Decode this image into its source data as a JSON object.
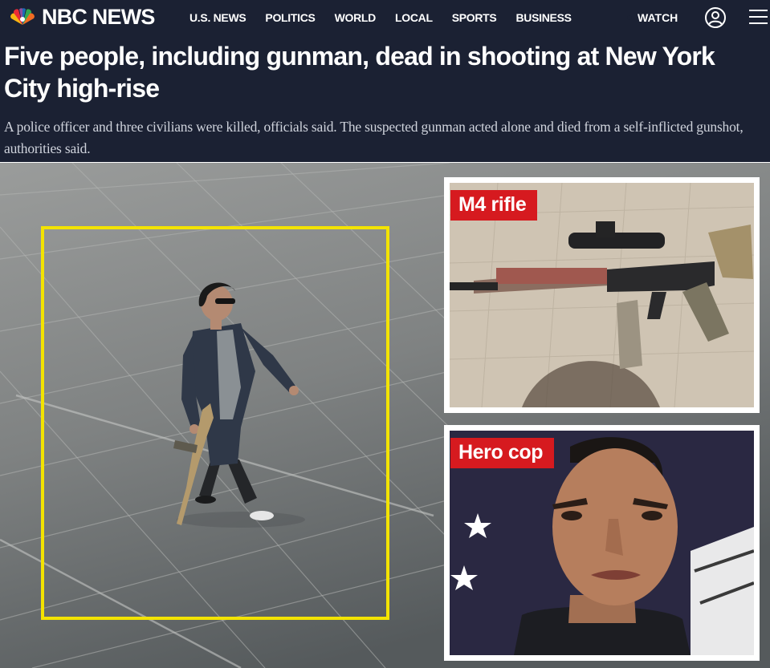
{
  "brand": {
    "name": "NBC NEWS",
    "logo_icon": "peacock-icon"
  },
  "nav": {
    "items": [
      "U.S. NEWS",
      "POLITICS",
      "WORLD",
      "LOCAL",
      "SPORTS",
      "BUSINESS"
    ],
    "watch_label": "WATCH",
    "account_icon": "user-circle-icon",
    "menu_icon": "hamburger-menu-icon"
  },
  "article": {
    "headline": "Five people, including gunman, dead in shooting at New York City high-rise",
    "dek": "A police officer and three civilians were killed, officials said. The suspected gunman acted alone and died from a self-inflicted gunshot, authorities said."
  },
  "image": {
    "insets": [
      {
        "label": "M4 rifle"
      },
      {
        "label": "Hero cop"
      }
    ],
    "highlight_color": "#f3e300",
    "tag_color": "#d61a1f"
  },
  "colors": {
    "header_bg": "#1b2133",
    "text_white": "#ffffff",
    "dek": "#cfd3dc"
  }
}
